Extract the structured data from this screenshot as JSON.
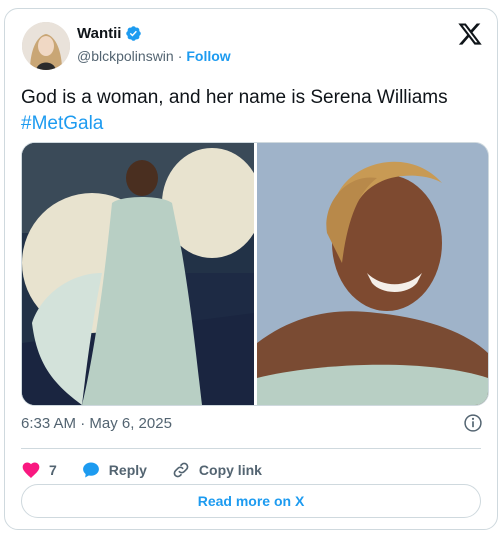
{
  "author": {
    "name": "Wantii",
    "handle": "@blckpolinswin",
    "separator": "·",
    "follow_label": "Follow"
  },
  "tweet": {
    "text": "God is a woman, and her name is Serena Williams",
    "hashtag": "#MetGala"
  },
  "timestamp": "6:33 AM · May 6, 2025",
  "actions": {
    "like_count": "7",
    "reply_label": "Reply",
    "copy_link_label": "Copy link"
  },
  "read_more_label": "Read more on X",
  "colors": {
    "accent": "#1d9bf0",
    "like": "#f91880",
    "muted": "#536471",
    "border": "#cfd9de"
  },
  "icons": [
    "verified-badge-icon",
    "x-logo-icon",
    "info-icon",
    "heart-icon",
    "reply-bubble-icon",
    "link-icon"
  ]
}
